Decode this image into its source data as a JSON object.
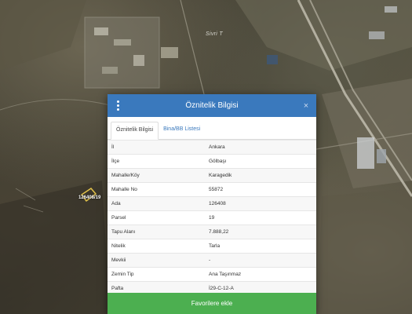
{
  "map": {
    "road_label": "Sivri T",
    "parcel_label": "126408/19"
  },
  "modal": {
    "title": "Öznitelik Bilgisi",
    "menu_icon": "vertical-ellipsis-icon",
    "close_icon": "close-icon",
    "close_symbol": "×",
    "colors": {
      "header": "#3a79bd",
      "button": "#4caf50",
      "link": "#3a79bd"
    }
  },
  "tabs": [
    {
      "label": "Öznitelik Bilgisi",
      "active": true
    },
    {
      "label": "Bina/BB Listesi",
      "active": false
    }
  ],
  "attributes": [
    {
      "key": "İl",
      "value": "Ankara"
    },
    {
      "key": "İlçe",
      "value": "Gölbaşı"
    },
    {
      "key": "Mahalle/Köy",
      "value": "Karagedik"
    },
    {
      "key": "Mahalle No",
      "value": "55872"
    },
    {
      "key": "Ada",
      "value": "126408"
    },
    {
      "key": "Parsel",
      "value": "19"
    },
    {
      "key": "Tapu Alanı",
      "value": "7.888,22"
    },
    {
      "key": "Nitelik",
      "value": "Tarla"
    },
    {
      "key": "Mevkii",
      "value": "-"
    },
    {
      "key": "Zemin Tip",
      "value": "Ana Taşınmaz"
    },
    {
      "key": "Pafta",
      "value": "İ29-C-12-A"
    }
  ],
  "footer": {
    "favorites_label": "Favorilere ekle"
  }
}
